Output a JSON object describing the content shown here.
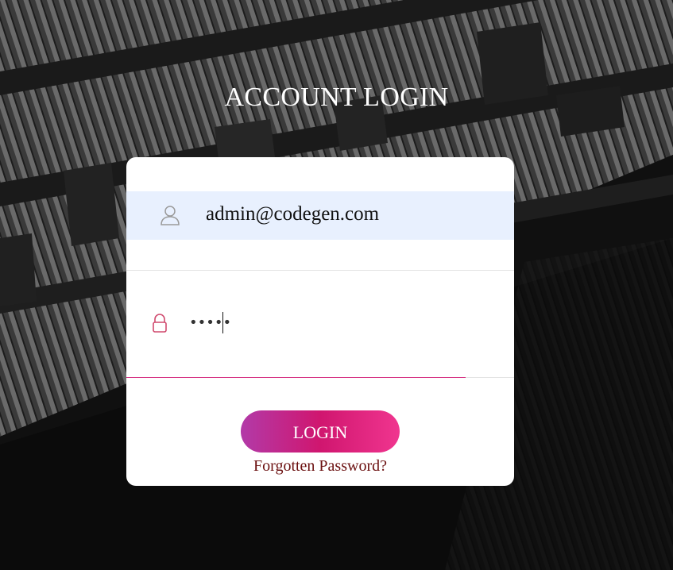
{
  "page": {
    "title": "ACCOUNT LOGIN"
  },
  "form": {
    "email": {
      "icon": "user-icon",
      "value": "admin@codegen.com"
    },
    "password": {
      "icon": "lock-icon",
      "masked_value": "•••••"
    },
    "login_label": "LOGIN",
    "forgot_label": "Forgotten Password?"
  },
  "colors": {
    "accent_start": "#b23aa8",
    "accent_mid": "#d0166f",
    "accent_end": "#f0358f",
    "forgot_text": "#6b1010",
    "email_field_bg": "#e8f0fe"
  }
}
